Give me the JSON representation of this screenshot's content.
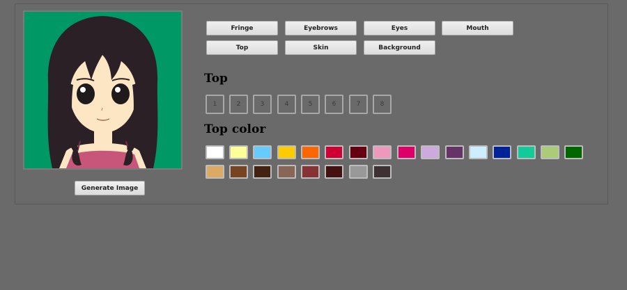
{
  "category_buttons": [
    "Fringe",
    "Eyebrows",
    "Eyes",
    "Mouth",
    "Top",
    "Skin",
    "Background"
  ],
  "generate_label": "Generate Image",
  "section_title": "Top",
  "option_numbers": [
    "1",
    "2",
    "3",
    "4",
    "5",
    "6",
    "7",
    "8"
  ],
  "color_section_title": "Top color",
  "colors": [
    "#ffffff",
    "#ffff99",
    "#66ccff",
    "#ffcc00",
    "#ff6600",
    "#cc0033",
    "#660011",
    "#ee99bb",
    "#dd0066",
    "#ccaadd",
    "#663366",
    "#cceeff",
    "#002299",
    "#11cc99",
    "#aacc77",
    "#006600",
    "#ddaa66",
    "#774422",
    "#442211",
    "#886655",
    "#883333",
    "#441111",
    "#999999",
    "#3d3134"
  ],
  "avatar_background": "#009966"
}
